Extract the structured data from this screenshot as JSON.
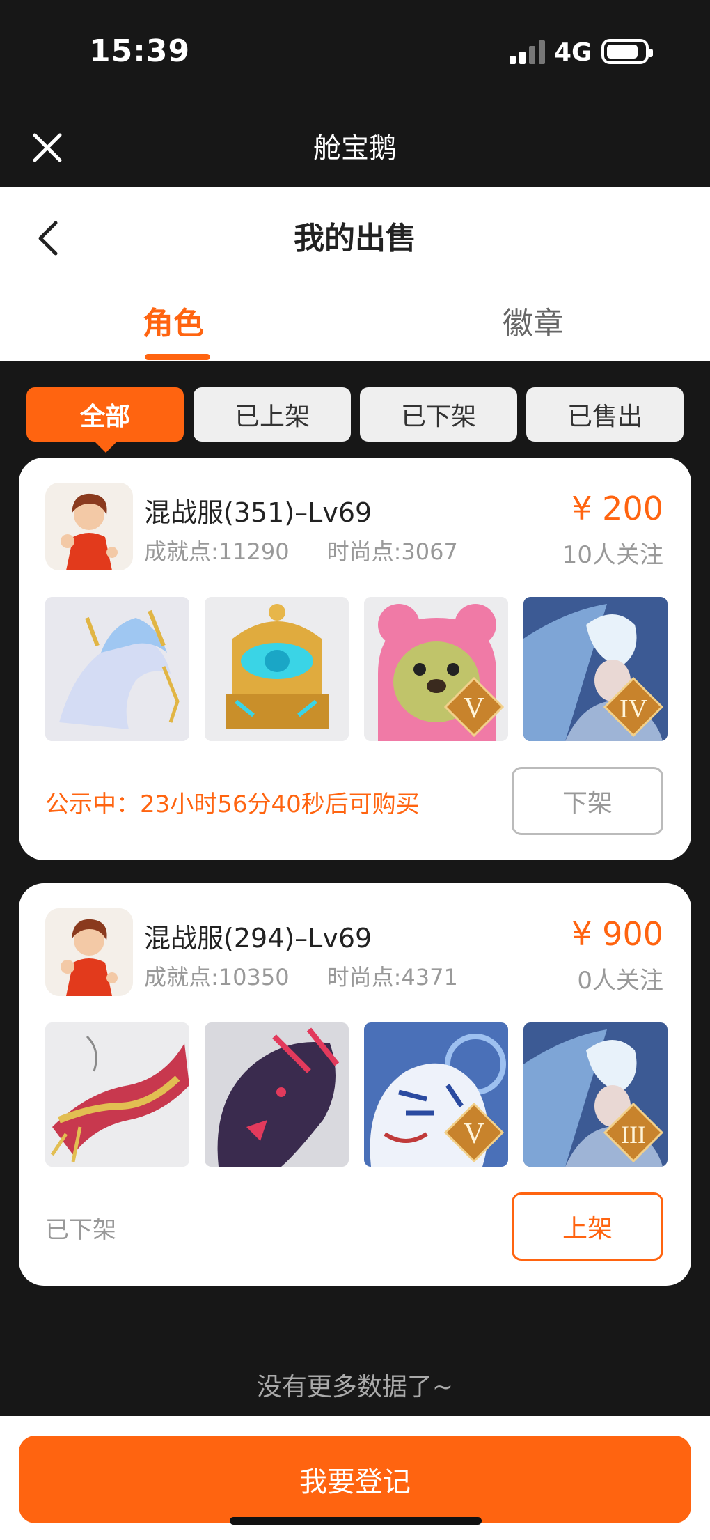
{
  "status_bar": {
    "time": "15:39",
    "network": "4G"
  },
  "miniapp": {
    "title": "舱宝鹅"
  },
  "header": {
    "title": "我的出售"
  },
  "tabs": [
    {
      "label": "角色",
      "active": true
    },
    {
      "label": "徽章",
      "active": false
    }
  ],
  "filters": [
    {
      "label": "全部",
      "active": true
    },
    {
      "label": "已上架",
      "active": false
    },
    {
      "label": "已下架",
      "active": false
    },
    {
      "label": "已售出",
      "active": false
    }
  ],
  "listings": [
    {
      "server": "混战服(351)–Lv69",
      "achievement": "成就点:11290",
      "fashion": "时尚点:3067",
      "price": "¥ 200",
      "followers": "10人关注",
      "items": [
        {
          "icon": "white-qilin-mount-icon",
          "rank": ""
        },
        {
          "icon": "golden-throne-icon",
          "rank": ""
        },
        {
          "icon": "pink-bear-pet-icon",
          "rank": "V"
        },
        {
          "icon": "ice-wing-warrior-icon",
          "rank": "IV"
        }
      ],
      "status": "公示中：23小时56分40秒后可购买",
      "action": "下架"
    },
    {
      "server": "混战服(294)–Lv69",
      "achievement": "成就点:10350",
      "fashion": "时尚点:4371",
      "price": "¥ 900",
      "followers": "0人关注",
      "items": [
        {
          "icon": "red-gold-dragon-icon",
          "rank": ""
        },
        {
          "icon": "dark-dragon-icon",
          "rank": ""
        },
        {
          "icon": "white-tiger-pet-icon",
          "rank": "V"
        },
        {
          "icon": "ice-wing-warrior-icon",
          "rank": "III"
        }
      ],
      "status": "已下架",
      "action": "上架"
    }
  ],
  "footer": {
    "no_more": "没有更多数据了~",
    "register": "我要登记"
  },
  "colors": {
    "accent": "#ff6410",
    "background": "#171717"
  }
}
